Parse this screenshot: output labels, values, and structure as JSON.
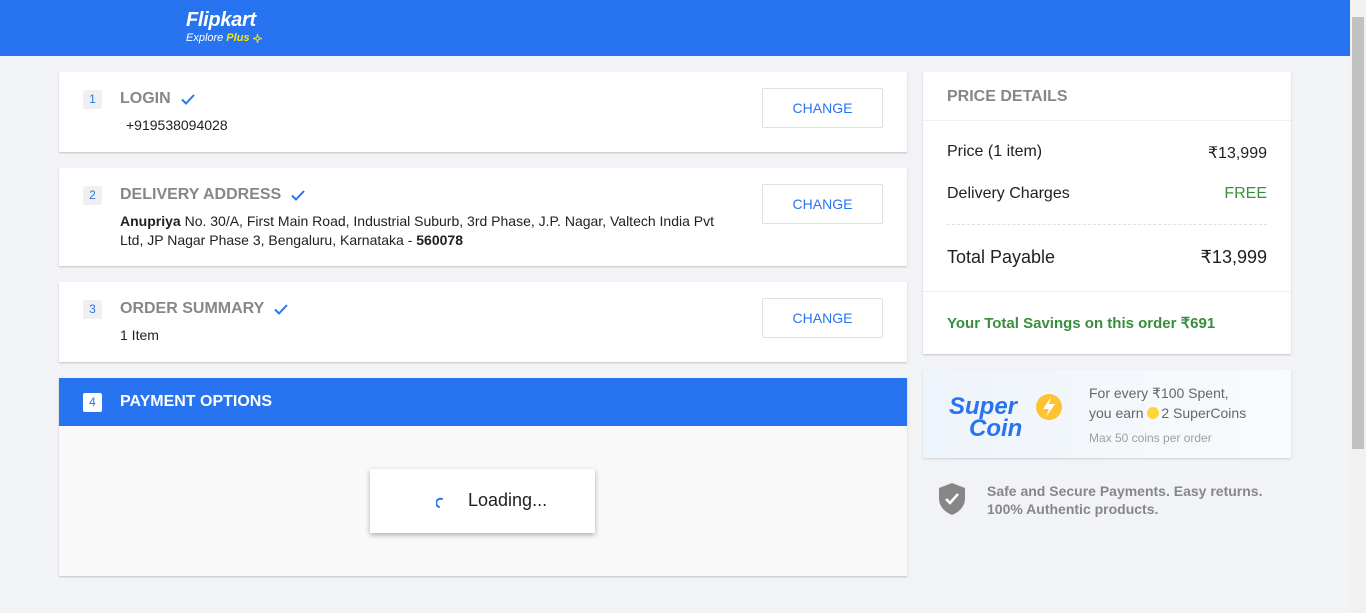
{
  "header": {
    "logo_main": "Flipkart",
    "logo_explore": "Explore",
    "logo_plus": "Plus",
    "brand_color": "#2874f0",
    "plus_color": "#ffe500"
  },
  "steps": [
    {
      "number": "1",
      "title": "LOGIN",
      "detail": "+919538094028",
      "change_label": "CHANGE"
    },
    {
      "number": "2",
      "title": "DELIVERY ADDRESS",
      "name": "Anupriya",
      "address": " No. 30/A, First Main Road, Industrial Suburb, 3rd Phase, J.P. Nagar, Valtech India Pvt Ltd, JP Nagar Phase 3, Bengaluru, Karnataka - ",
      "pincode": "560078",
      "change_label": "CHANGE"
    },
    {
      "number": "3",
      "title": "ORDER SUMMARY",
      "detail": "1 Item",
      "change_label": "CHANGE"
    }
  ],
  "payment": {
    "number": "4",
    "title": "PAYMENT OPTIONS",
    "loading_text": "Loading..."
  },
  "price_details": {
    "title": "PRICE DETAILS",
    "price_label": "Price (1 item)",
    "price_value": "₹13,999",
    "delivery_label": "Delivery Charges",
    "delivery_value": "FREE",
    "total_label": "Total Payable",
    "total_value": "₹13,999",
    "savings_text": "Your Total Savings on this order ₹691",
    "savings_color": "#388e3c"
  },
  "supercoin": {
    "logo_word1": "Super",
    "logo_word2": "Coin",
    "line1": "For every ₹100 Spent,",
    "line2_prefix": "you earn ",
    "line2_suffix": "2 SuperCoins",
    "line3": "Max 50 coins per order"
  },
  "safe": {
    "text": "Safe and Secure Payments. Easy returns. 100% Authentic products.",
    "icon": "shield-check-icon"
  }
}
